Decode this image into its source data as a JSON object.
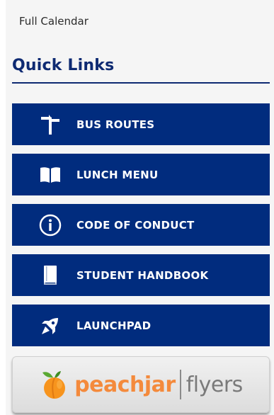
{
  "full_calendar_link": "Full Calendar",
  "quick_links": {
    "heading": "Quick Links",
    "items": [
      {
        "label": "BUS ROUTES",
        "icon": "signpost-icon"
      },
      {
        "label": "LUNCH MENU",
        "icon": "book-open-icon"
      },
      {
        "label": "CODE OF CONDUCT",
        "icon": "info-icon"
      },
      {
        "label": "STUDENT HANDBOOK",
        "icon": "handbook-icon"
      },
      {
        "label": "LAUNCHPAD",
        "icon": "rocket-icon"
      }
    ]
  },
  "peachjar": {
    "name": "peachjar",
    "flyers": "flyers",
    "logo_icon": "peach-icon"
  },
  "colors": {
    "button_bg": "#012c7e",
    "heading": "#0e2a72",
    "peach_orange": "#f48a3c"
  }
}
